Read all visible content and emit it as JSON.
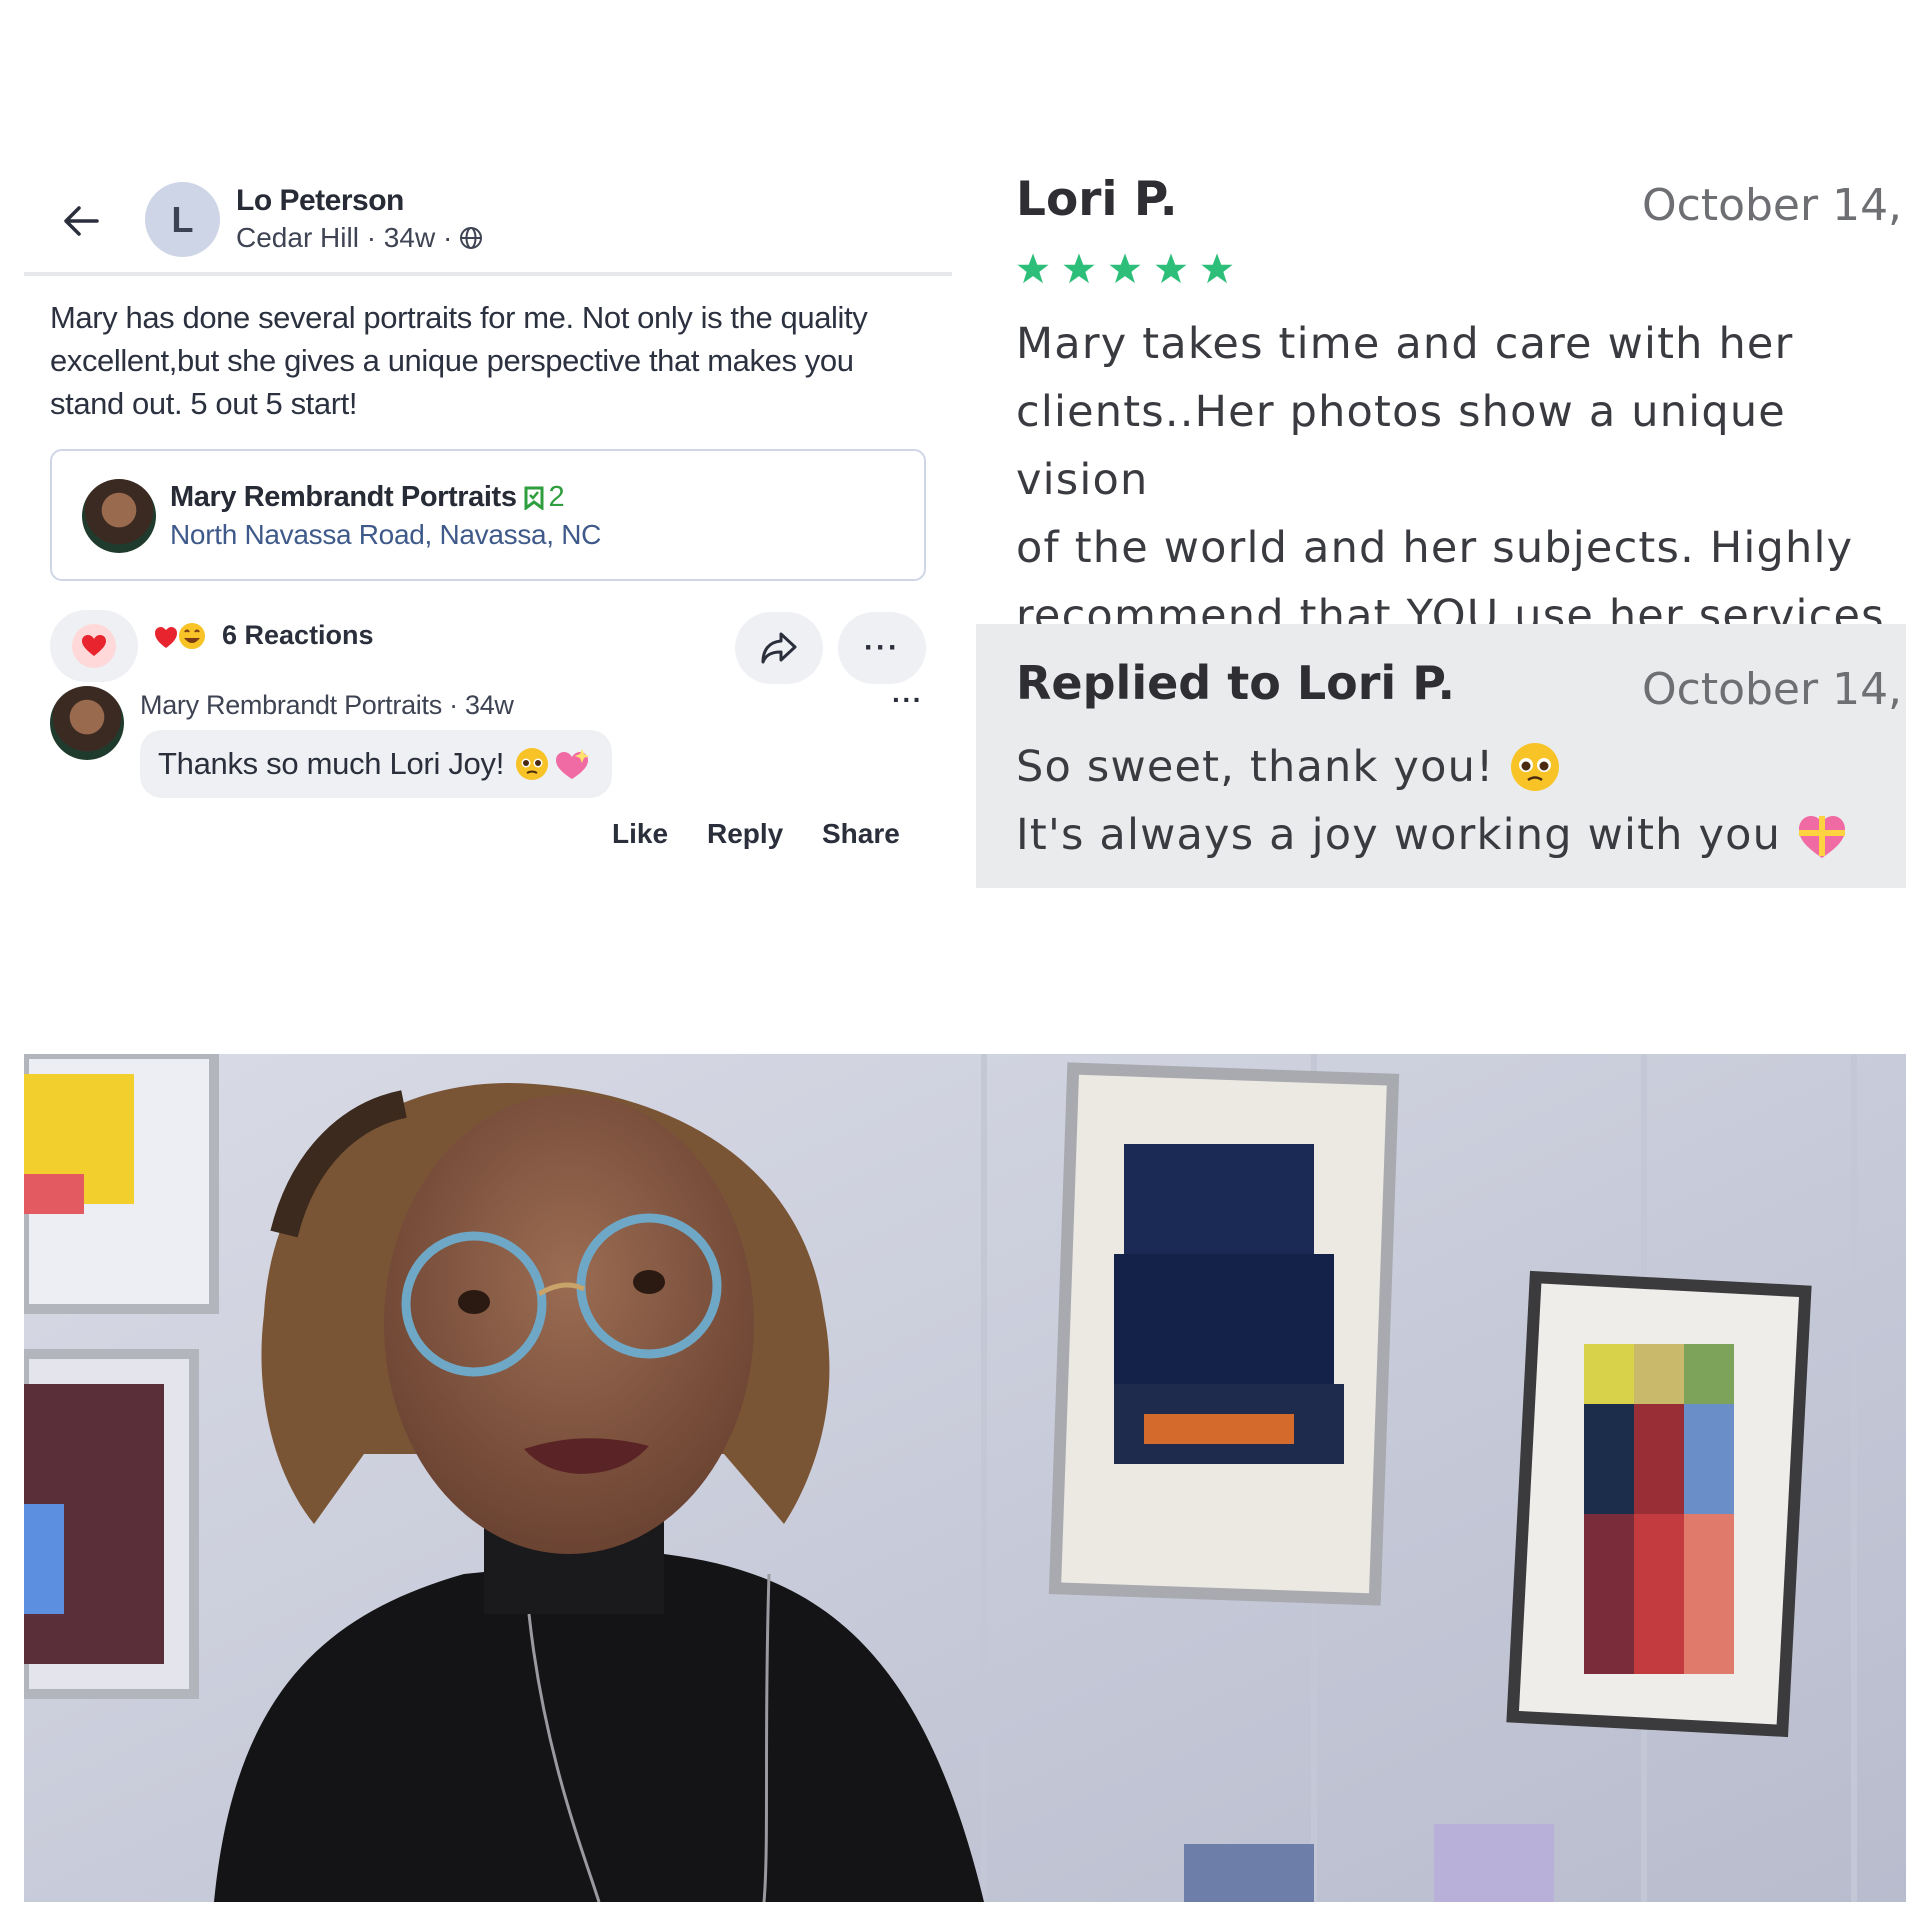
{
  "left_post": {
    "author_initial": "L",
    "author_name": "Lo Peterson",
    "author_meta": "Cedar Hill · 34w ·",
    "body": "Mary has done several portraits for me. Not only is the quality excellent,but she gives a unique perspective that makes you stand out. 5 out 5 start!",
    "business": {
      "name": "Mary Rembrandt Portraits",
      "badge_count": "2",
      "address": "North Navassa Road, Navassa, NC"
    },
    "reactions_label": "6 Reactions",
    "reply": {
      "author": "Mary Rembrandt Portraits · 34w",
      "more": "···",
      "text": "Thanks so much Lori Joy!"
    },
    "actions": {
      "like": "Like",
      "reply": "Reply",
      "share": "Share"
    },
    "more_label": "···"
  },
  "right_review": {
    "reviewer": "Lori P.",
    "date": "October 14,",
    "rating": 5,
    "text": "Mary takes time and care with her\nclients..Her photos show a unique vision\nof the world and her subjects. Highly\nrecommend that YOU use her services",
    "reply_title": "Replied to Lori P.",
    "reply_date": "October 14,",
    "reply_line1": "So sweet, thank you!",
    "reply_line2": "It's always a joy working with you"
  },
  "colors": {
    "star_green": "#2dbf7a",
    "badge_green": "#2e9e3f",
    "reply_box_bg": "#e9ebec"
  },
  "icons": [
    "back-arrow-icon",
    "globe-icon",
    "bookmark-badge-icon",
    "heart-icon",
    "share-arrow-icon",
    "star-icon",
    "pleading-face-icon",
    "sparkling-heart-icon",
    "gift-heart-icon"
  ]
}
